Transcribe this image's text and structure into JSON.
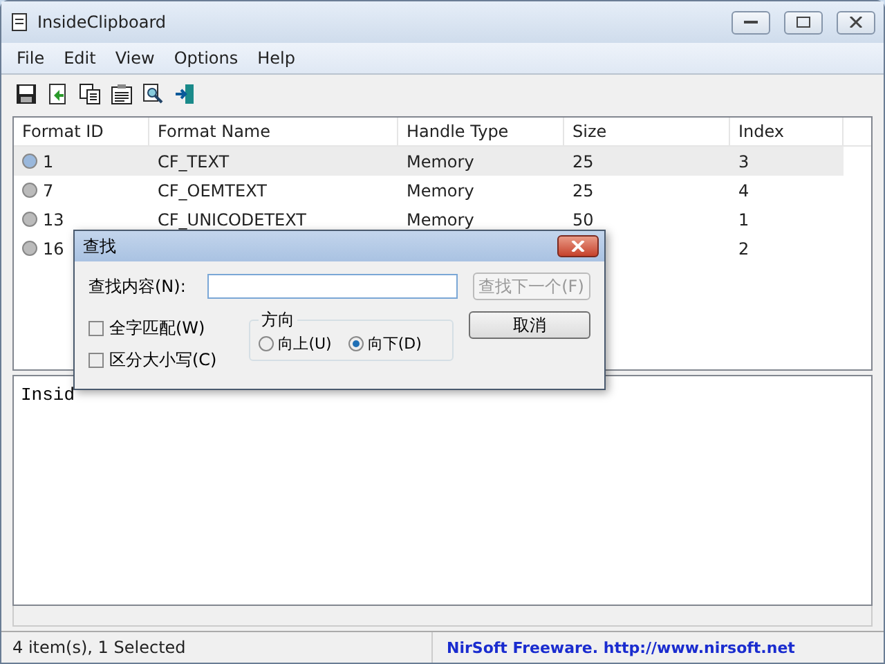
{
  "window": {
    "title": "InsideClipboard"
  },
  "menu": [
    "File",
    "Edit",
    "View",
    "Options",
    "Help"
  ],
  "toolbar": [
    {
      "kind": "save"
    },
    {
      "kind": "refresh"
    },
    {
      "kind": "copy"
    },
    {
      "kind": "properties"
    },
    {
      "kind": "find"
    },
    {
      "kind": "exit"
    }
  ],
  "table": {
    "columns": [
      "Format ID",
      "Format Name",
      "Handle Type",
      "Size",
      "Index"
    ],
    "rows": [
      {
        "selected": true,
        "cells": [
          "1",
          "CF_TEXT",
          "Memory",
          "25",
          "3"
        ]
      },
      {
        "selected": false,
        "cells": [
          "7",
          "CF_OEMTEXT",
          "Memory",
          "25",
          "4"
        ]
      },
      {
        "selected": false,
        "cells": [
          "13",
          "CF_UNICODETEXT",
          "Memory",
          "50",
          "1"
        ]
      },
      {
        "selected": false,
        "cells": [
          "16",
          null,
          null,
          null,
          "2"
        ]
      }
    ]
  },
  "text_pane": {
    "text": "Insid"
  },
  "find_dialog": {
    "title": "查找",
    "find_label": "查找内容(N):",
    "find_next": {
      "label": "查找下一个(F)",
      "disabled": true
    },
    "cancel": "取消",
    "options": [
      {
        "label": "全字匹配(W)",
        "checked": false
      },
      {
        "label": "区分大小写(C)",
        "checked": false
      }
    ],
    "direction": {
      "label": "方向",
      "choices": [
        {
          "label": "向上(U)",
          "selected": false
        },
        {
          "label": "向下(D)",
          "selected": true
        }
      ]
    }
  },
  "status_bar": {
    "count": "4 item(s), 1 Selected",
    "link": "NirSoft Freeware.  http://www.nirsoft.net"
  }
}
